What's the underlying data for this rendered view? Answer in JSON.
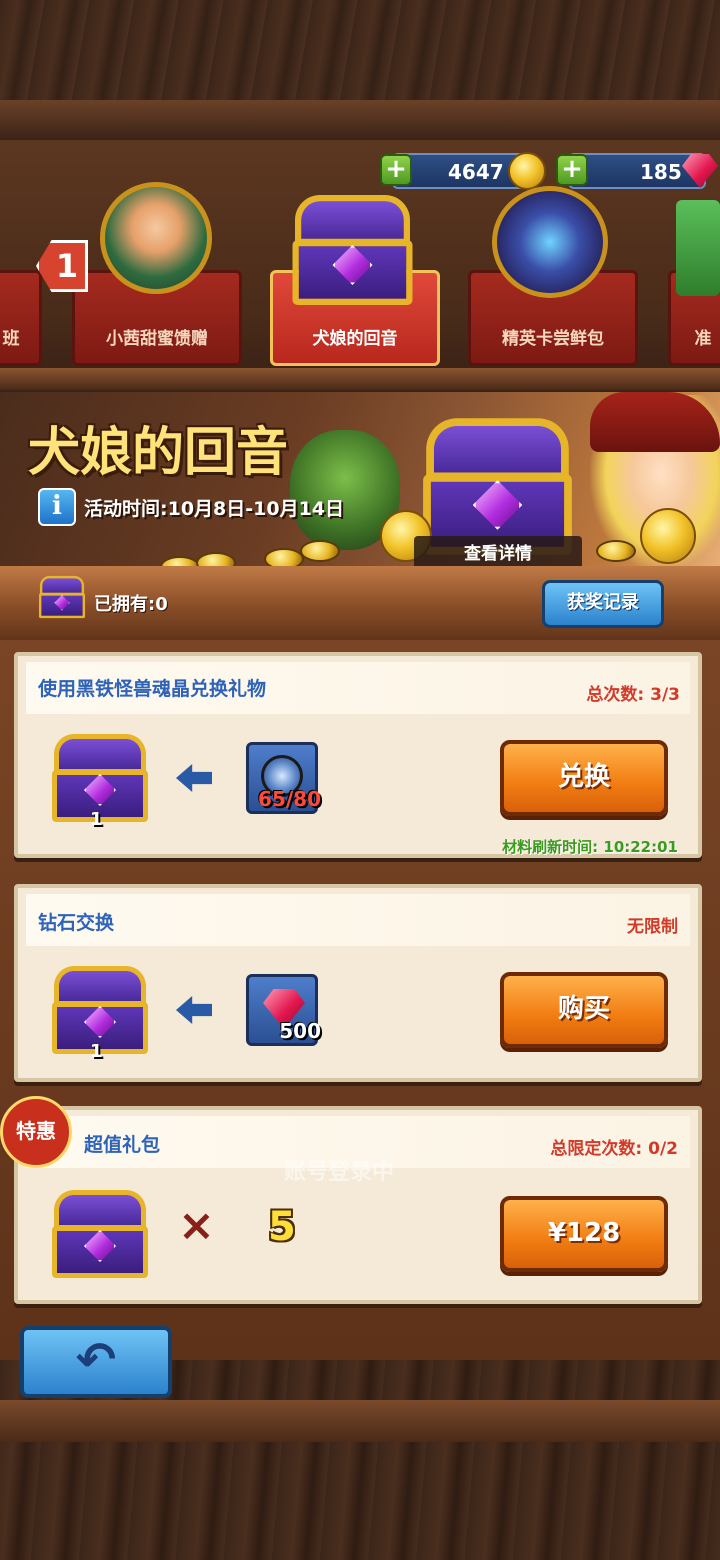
{
  "currency": {
    "gold": "4647",
    "gems": "185",
    "plus": "+"
  },
  "tabs": [
    {
      "label": "班"
    },
    {
      "label": "小茜甜蜜馈赠"
    },
    {
      "label": "犬娘的回音"
    },
    {
      "label": "精英卡尝鲜包"
    },
    {
      "label": "准"
    }
  ],
  "tab_badge": "1",
  "banner": {
    "title": "犬娘的回音",
    "info": "i",
    "event_time": "活动时间:10月8日-10月14日",
    "view_detail": "查看详情"
  },
  "owned": "已拥有:0",
  "record_button": "获奖记录",
  "panels": [
    {
      "title": "使用黑铁怪兽魂晶兑换礼物",
      "limit": "总次数: 3/3",
      "chest_qty": "1",
      "cost": "65/80",
      "button": "兑换",
      "refresh": "材料刷新时间: 10:22:01"
    },
    {
      "title": "钻石交换",
      "limit": "无限制",
      "chest_qty": "1",
      "cost": "500",
      "button": "购买"
    },
    {
      "title": "超值礼包",
      "limit": "总限定次数: 0/2",
      "badge": "特惠",
      "times": "×",
      "qty": "5",
      "button": "¥128",
      "overlay": "账号登录中"
    }
  ],
  "back_button": "↶",
  "colors": {
    "accent_orange": "#f07c12",
    "title_blue": "#2f63b8",
    "limit_red": "#d23a2a",
    "refresh_green": "#3c9a1e"
  }
}
